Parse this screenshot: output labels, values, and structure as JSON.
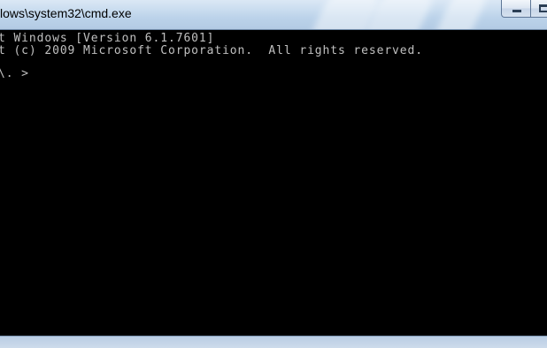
{
  "window": {
    "title": "lows\\system32\\cmd.exe"
  },
  "console": {
    "lines": [
      "t Windows [Version 6.1.7601]",
      "t (c) 2009 Microsoft Corporation.  All rights reserved."
    ],
    "prompt": "\\. >"
  },
  "icons": {
    "minimize": "minimize-icon",
    "maximize": "maximize-icon"
  },
  "colors": {
    "console_bg": "#000000",
    "console_text": "#c0c0c0",
    "titlebar": "#c9dcef"
  }
}
